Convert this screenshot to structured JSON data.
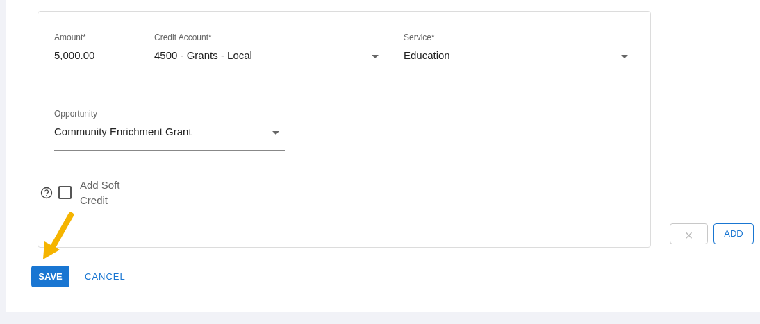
{
  "fields": [
    {
      "kind": "text",
      "label": "Amount*",
      "value": "5,000.00"
    },
    {
      "kind": "select",
      "label": "Credit Account*",
      "value": "4500 - Grants - Local"
    },
    {
      "kind": "select",
      "label": "Service*",
      "value": "Education"
    },
    {
      "kind": "select",
      "label": "Opportunity",
      "value": "Community Enrichment Grant"
    }
  ],
  "soft_credit": {
    "label": "Add Soft Credit",
    "checked": false
  },
  "row_buttons": [
    {
      "kind": "remove",
      "label": "×",
      "disabled": true
    },
    {
      "kind": "add",
      "label": "ADD",
      "disabled": false
    }
  ],
  "footer_buttons": [
    {
      "kind": "primary",
      "label": "SAVE"
    },
    {
      "kind": "link",
      "label": "CANCEL"
    }
  ]
}
